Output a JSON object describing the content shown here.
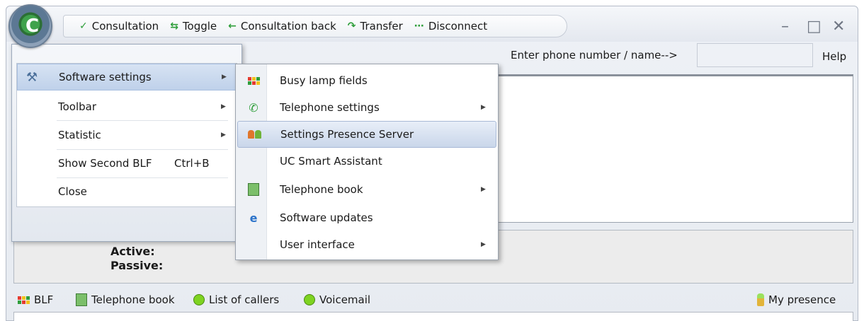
{
  "toolbar": {
    "consultation": "Consultation",
    "toggle": "Toggle",
    "consultation_back": "Consultation back",
    "transfer": "Transfer",
    "disconnect": "Disconnect"
  },
  "logo_letter": "C",
  "window_controls": {
    "minimize": "–",
    "maximize": "□",
    "close": "✕"
  },
  "phone": {
    "label": "Enter phone number / name-->",
    "value": ""
  },
  "help": "Help",
  "main_menu": [
    {
      "label": "Software settings",
      "shortcut": "",
      "has_submenu": true,
      "highlighted": true
    },
    {
      "label": "Toolbar",
      "shortcut": "",
      "has_submenu": true
    },
    {
      "label": "Statistic",
      "shortcut": "",
      "has_submenu": true
    },
    {
      "label": "Show Second BLF",
      "shortcut": "Ctrl+B",
      "has_submenu": false
    },
    {
      "label": "Close",
      "shortcut": "",
      "has_submenu": false
    }
  ],
  "submenu": [
    {
      "label": "Busy lamp fields",
      "icon": "blf-icon"
    },
    {
      "label": "Telephone settings",
      "icon": "phone-icon",
      "has_submenu": true
    },
    {
      "label": "Settings Presence Server",
      "icon": "presence-server-icon",
      "highlighted": true
    },
    {
      "label": "UC Smart Assistant",
      "icon": ""
    },
    {
      "label": "Telephone book",
      "icon": "phonebook-icon",
      "has_submenu": true
    },
    {
      "label": "Software updates",
      "icon": "internet-icon"
    },
    {
      "label": "User interface",
      "icon": "",
      "has_submenu": true
    }
  ],
  "status": {
    "active_label": "Active:",
    "passive_label": "Passive:"
  },
  "bottom_tabs": {
    "blf": "BLF",
    "telephone_book": "Telephone book",
    "list_of_callers": "List of callers",
    "voicemail": "Voicemail",
    "my_presence": "My presence"
  },
  "colors": {
    "accent_green": "#2e9e3a",
    "highlight_blue": "#c9d6ea",
    "frame_blue": "#9eabbd"
  }
}
